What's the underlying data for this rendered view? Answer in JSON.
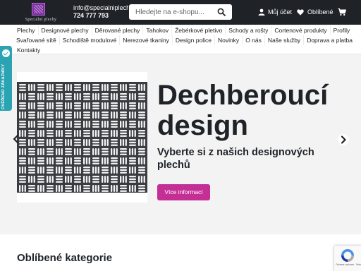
{
  "header": {
    "logo_text": "Speciální plechy",
    "email": "info@specialniplechy.c",
    "phone": "724 777 793",
    "search_placeholder": "Hledejte na e-shopu...",
    "account_label": "Můj účet",
    "favorites_label": "Oblíbené"
  },
  "nav": {
    "row1": [
      "Plechy",
      "Designové plechy",
      "Děrované plechy",
      "Tahokov",
      "Žebérkové pletivo",
      "Schody a rošty",
      "Cortenové produkty",
      "Profily"
    ],
    "row2": [
      "Svařované sítě",
      "Schodiště modulové",
      "Nerezové tkaniny",
      "Design police",
      "Novinky",
      "O nás",
      "Naše služby",
      "Doprava a platba"
    ],
    "row3": [
      "Kontakty"
    ]
  },
  "badge": {
    "text": "OVĚŘENO ZÁKAZNÍKY"
  },
  "hero": {
    "title": "Dechberoucí design",
    "subtitle": "Vyberte si z našich designových plechů",
    "button_label": "Více informací"
  },
  "categories": {
    "title": "Oblíbené kategorie"
  },
  "recaptcha": {
    "text": "Ochrana soukromí · Smluvní podmínky"
  },
  "colors": {
    "topbar": "#1f2327",
    "accent": "#c42f96",
    "badge": "#2aa3b3",
    "hero_bg": "#f3f3f3"
  },
  "icons": {
    "search": "search-icon",
    "account": "user-icon",
    "favorites": "heart-icon",
    "cart": "cart-icon",
    "prev": "chevron-left-icon",
    "next": "chevron-right-icon"
  }
}
